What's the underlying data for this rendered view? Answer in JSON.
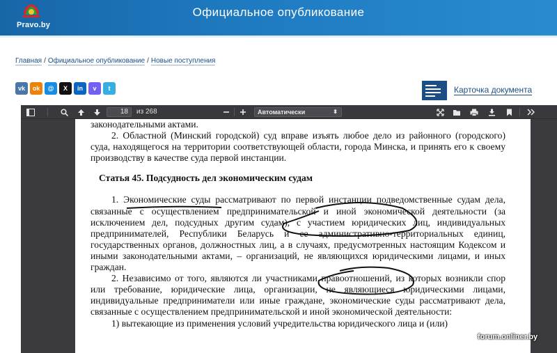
{
  "header": {
    "logo_text": "Pravo.by",
    "title": "Официальное опубликование"
  },
  "breadcrumb": {
    "items": [
      "Главная",
      "Официальное опубликование",
      "Новые поступления"
    ],
    "separator": "/"
  },
  "share": {
    "buttons": [
      {
        "name": "vk",
        "label": "vk",
        "color": "#4a76a8"
      },
      {
        "name": "odnoklassniki",
        "label": "ok",
        "color": "#ee8208"
      },
      {
        "name": "moimir",
        "label": "@",
        "color": "#168de2"
      },
      {
        "name": "x",
        "label": "X",
        "color": "#111111"
      },
      {
        "name": "linkedin",
        "label": "in",
        "color": "#0a66c2"
      },
      {
        "name": "viber",
        "label": "v",
        "color": "#7360f2"
      },
      {
        "name": "telegram",
        "label": "t",
        "color": "#37aee2"
      }
    ]
  },
  "doc_card": {
    "link_text": "Карточка документа"
  },
  "viewer": {
    "page_current": "18",
    "page_total_text": "из 268",
    "zoom": "Автоматически",
    "icons": [
      "sidebar-toggle-icon",
      "search-icon",
      "prev-page-icon",
      "next-page-icon",
      "zoom-out-icon",
      "zoom-in-icon",
      "presentation-icon",
      "open-file-icon",
      "print-icon",
      "download-icon",
      "bookmark-icon",
      "tools-icon"
    ]
  },
  "document": {
    "paragraphs": [
      {
        "text": "законодательными актами.",
        "style": "plain"
      },
      {
        "text": "2. Областной (Минский городской) суд вправе изъять любое дело из районного (городского) суда, находящегося на территории соответствующей области, города Минска, и принять его к своему производству в качестве суда первой инстанции.",
        "style": "ind"
      },
      {
        "text": "Статья 45. Подсудность дел экономическим судам",
        "style": "head"
      },
      {
        "text": "1. Экономические суды рассматривают по первой инстанции подведомственные судам дела, связанные с осуществлением предпринимательской и иной экономической деятельности (за исключением дел, подсудных другим судам), с участием юридических лиц, индивидуальных предпринимателей, Республики Беларусь и ее административно-территориальных единиц, государственных органов, должностных лиц, а в случаях, предусмотренных настоящим Кодексом и иными законодательными актами, – организаций, не являющихся юридическими лицами, и иных граждан.",
        "style": "ind"
      },
      {
        "text": "2. Независимо от того, являются ли участниками правоотношений, из которых возникли спор или требование, юридические лица, организации, не являющиеся юридическими лицами, индивидуальные предприниматели или иные граждане, экономические суды рассматривают дела, связанные с осуществлением предпринимательской и иной экономической деятельности:",
        "style": "ind"
      },
      {
        "text": "1) вытекающие из применения условий учредительства юридического лица и (или)",
        "style": "ind"
      }
    ]
  },
  "watermark": "forum.onliner.by"
}
